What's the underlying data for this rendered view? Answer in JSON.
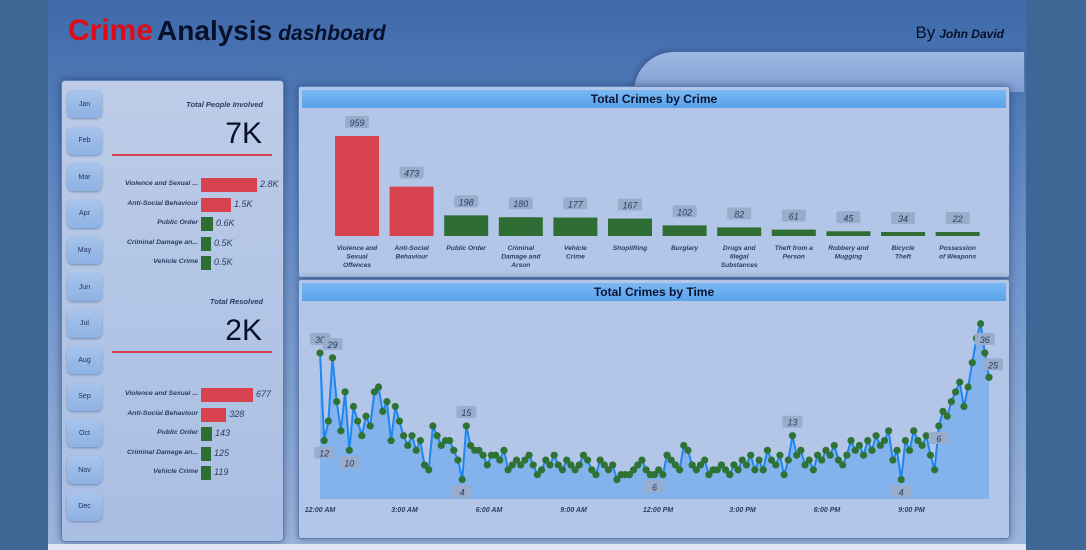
{
  "header": {
    "title_crime": "Crime",
    "title_analysis": "Analysis",
    "title_dashboard": "dashboard",
    "by_label": "By",
    "author": "John David"
  },
  "months": [
    "Jan",
    "Feb",
    "Mar",
    "Apr",
    "May",
    "Jun",
    "Jul",
    "Aug",
    "Sep",
    "Oct",
    "Nov",
    "Dec"
  ],
  "kpi_people": {
    "label": "Total People Involved",
    "value": "7K",
    "bars": [
      {
        "category": "Violence and Sexual ...",
        "value_label": "2.8K",
        "value": 2800,
        "color": "#d6434f"
      },
      {
        "category": "Anti-Social Behaviour",
        "value_label": "1.5K",
        "value": 1500,
        "color": "#d6434f"
      },
      {
        "category": "Public Order",
        "value_label": "0.6K",
        "value": 600,
        "color": "#2e6e34"
      },
      {
        "category": "Criminal Damage an...",
        "value_label": "0.5K",
        "value": 500,
        "color": "#2e6e34"
      },
      {
        "category": "Vehicle Crime",
        "value_label": "0.5K",
        "value": 500,
        "color": "#2e6e34"
      }
    ]
  },
  "kpi_resolved": {
    "label": "Total Resolved",
    "value": "2K",
    "bars": [
      {
        "category": "Violence and Sexual ...",
        "value_label": "677",
        "value": 677,
        "color": "#d6434f"
      },
      {
        "category": "Anti-Social Behaviour",
        "value_label": "328",
        "value": 328,
        "color": "#d6434f"
      },
      {
        "category": "Public Order",
        "value_label": "143",
        "value": 143,
        "color": "#2e6e34"
      },
      {
        "category": "Criminal Damage an...",
        "value_label": "125",
        "value": 125,
        "color": "#2e6e34"
      },
      {
        "category": "Vehicle Crime",
        "value_label": "119",
        "value": 119,
        "color": "#2e6e34"
      }
    ]
  },
  "crimes_by_crime": {
    "title": "Total Crimes by Crime",
    "chart_data": {
      "type": "bar",
      "categories": [
        "Violence and Sexual Offences",
        "Anti-Social Behaviour",
        "Public Order",
        "Criminal Damage and Arson",
        "Vehicle Crime",
        "Shoplifting",
        "Burglary",
        "Drugs and Illegal Substances",
        "Theft from a Person",
        "Robbery and Mugging",
        "Bicycle Theft",
        "Possession of Weapons"
      ],
      "values": [
        959,
        473,
        198,
        180,
        177,
        167,
        102,
        82,
        61,
        45,
        34,
        22
      ],
      "colors": [
        "#d6434f",
        "#d6434f",
        "#2e6e34",
        "#2e6e34",
        "#2e6e34",
        "#2e6e34",
        "#2e6e34",
        "#2e6e34",
        "#2e6e34",
        "#2e6e34",
        "#2e6e34",
        "#2e6e34"
      ]
    }
  },
  "crimes_by_time": {
    "title": "Total Crimes by Time",
    "chart_data": {
      "type": "area",
      "x_tick_labels": [
        "12:00 AM",
        "3:00 AM",
        "6:00 AM",
        "9:00 AM",
        "12:00 PM",
        "3:00 PM",
        "6:00 PM",
        "9:00 PM"
      ],
      "labeled_points": [
        30,
        12,
        29,
        10,
        15,
        6,
        4,
        13,
        4,
        36,
        25,
        6
      ],
      "values": [
        30,
        12,
        16,
        29,
        20,
        14,
        22,
        10,
        19,
        16,
        13,
        17,
        15,
        22,
        23,
        18,
        20,
        12,
        19,
        16,
        13,
        11,
        13,
        10,
        12,
        7,
        6,
        15,
        13,
        11,
        12,
        12,
        10,
        8,
        4,
        15,
        11,
        10,
        10,
        9,
        7,
        9,
        9,
        8,
        10,
        6,
        7,
        8,
        7,
        8,
        9,
        7,
        5,
        6,
        8,
        7,
        9,
        7,
        6,
        8,
        7,
        6,
        7,
        9,
        8,
        6,
        5,
        8,
        7,
        6,
        7,
        4,
        5,
        5,
        5,
        6,
        7,
        8,
        6,
        5,
        5,
        6,
        5,
        9,
        8,
        7,
        6,
        11,
        10,
        7,
        6,
        7,
        8,
        5,
        6,
        6,
        7,
        6,
        5,
        7,
        6,
        8,
        7,
        9,
        6,
        8,
        6,
        10,
        8,
        7,
        9,
        5,
        8,
        13,
        9,
        10,
        7,
        8,
        6,
        9,
        8,
        10,
        9,
        11,
        8,
        7,
        9,
        12,
        10,
        11,
        9,
        12,
        10,
        13,
        11,
        12,
        14,
        8,
        10,
        4,
        12,
        10,
        14,
        12,
        11,
        13,
        9,
        6,
        15,
        18,
        17,
        20,
        22,
        24,
        19,
        23,
        28,
        33,
        36,
        30,
        25
      ],
      "ylim": [
        0,
        38
      ]
    }
  }
}
